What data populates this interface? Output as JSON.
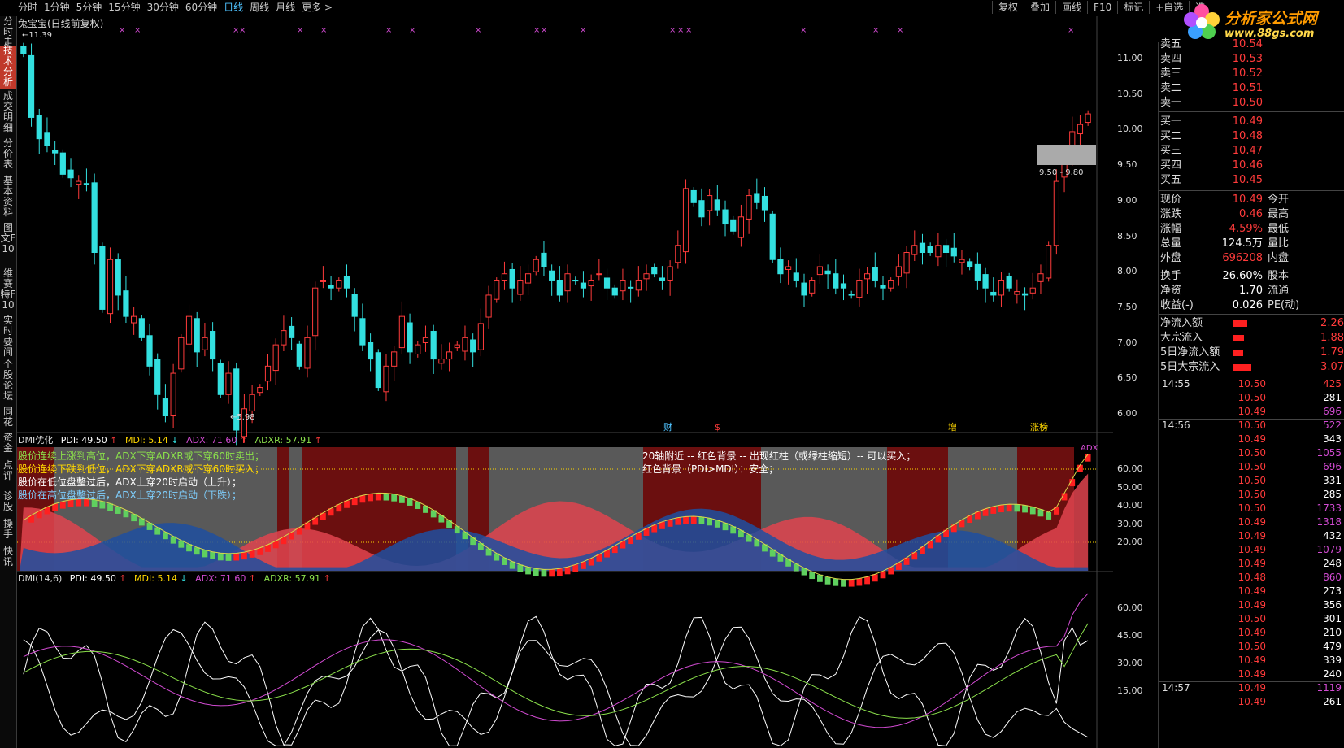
{
  "periods": [
    "分时",
    "1分钟",
    "5分钟",
    "15分钟",
    "30分钟",
    "60分钟",
    "日线",
    "周线",
    "月线",
    "更多 >"
  ],
  "active_period": "日线",
  "tools": [
    "复权",
    "叠加",
    "画线",
    "F10",
    "标记",
    "+自选",
    "选"
  ],
  "logo": {
    "line1": "分析家公式网",
    "line2": "www.88gs.com"
  },
  "left_tabs": [
    "分时走势",
    "技术分析",
    "成交明细",
    "分价表",
    "基本资料",
    "图文F10",
    "维赛特F10",
    "实时要闻",
    "个股论坛",
    "同花",
    "资金",
    "点评",
    "诊股",
    "操手",
    "快讯"
  ],
  "stock_title": "兔宝宝(日线前复权)",
  "candles_panel": {
    "high_label": "11.39",
    "low_label": "5.98",
    "range_label": "9.50 - 9.80",
    "y_ticks": [
      "11.00",
      "10.50",
      "10.00",
      "9.50",
      "9.00",
      "8.50",
      "8.00",
      "7.50",
      "7.00",
      "6.50",
      "6.00"
    ],
    "event_marks": [
      "财",
      "$",
      "增",
      "涨榜"
    ]
  },
  "dmi_opt": {
    "name": "DMI优化",
    "pdi": "PDI: 49.50",
    "mdi": "MDI: 5.14",
    "adx": "ADX: 71.60",
    "adxr": "ADXR: 57.91",
    "notes_left": [
      "股价连续上涨到高位，ADX下穿ADXR或下穿60时卖出；",
      "股价连续下跌到低位，ADX下穿ADXR或下穿60时买入；",
      "股价在低位盘整过后，ADX上穿20时启动（上升）；",
      "股价在高位盘整过后，ADX上穿20时启动（下跌）；"
    ],
    "notes_mid": [
      "20轴附近 -- 红色背景 -- 出现红柱（或绿柱缩短）-- 可以买入；",
      "红色背景（PDI>MDI）：安全；"
    ],
    "y_ticks": [
      "60.00",
      "50.00",
      "40.00",
      "30.00",
      "20.00"
    ],
    "tag": "ADX"
  },
  "dmi": {
    "name": "DMI(14,6)",
    "pdi": "PDI: 49.50",
    "mdi": "MDI: 5.14",
    "adx": "ADX: 71.60",
    "adxr": "ADXR: 57.91",
    "y_ticks": [
      "60.00",
      "45.00",
      "30.00",
      "15.00"
    ]
  },
  "quote": {
    "asks": [
      {
        "label": "卖五",
        "price": "10.54"
      },
      {
        "label": "卖四",
        "price": "10.53"
      },
      {
        "label": "卖三",
        "price": "10.52"
      },
      {
        "label": "卖二",
        "price": "10.51"
      },
      {
        "label": "卖一",
        "price": "10.50"
      }
    ],
    "bids": [
      {
        "label": "买一",
        "price": "10.49"
      },
      {
        "label": "买二",
        "price": "10.48"
      },
      {
        "label": "买三",
        "price": "10.47"
      },
      {
        "label": "买四",
        "price": "10.46"
      },
      {
        "label": "买五",
        "price": "10.45"
      }
    ],
    "stats": [
      {
        "l1": "现价",
        "v1": "10.49",
        "l2": "今开",
        "v2": ""
      },
      {
        "l1": "涨跌",
        "v1": "0.46",
        "l2": "最高",
        "v2": ""
      },
      {
        "l1": "涨幅",
        "v1": "4.59%",
        "l2": "最低",
        "v2": ""
      },
      {
        "l1": "总量",
        "v1": "124.5万",
        "l2": "量比",
        "v2": ""
      },
      {
        "l1": "外盘",
        "v1": "696208",
        "l2": "内盘",
        "v2": ""
      }
    ],
    "stats2": [
      {
        "l1": "换手",
        "v1": "26.60%",
        "l2": "股本",
        "v2": ""
      },
      {
        "l1": "净资",
        "v1": "1.70",
        "l2": "流通",
        "v2": ""
      },
      {
        "l1": "收益(-)",
        "v1": "0.026",
        "l2": "PE(动)",
        "v2": ""
      }
    ],
    "flows": [
      {
        "label": "净流入额",
        "value": "2.26",
        "bar": 0.75
      },
      {
        "label": "大宗流入",
        "value": "1.88",
        "bar": 0.6
      },
      {
        "label": "5日净流入额",
        "value": "1.79",
        "bar": 0.55
      },
      {
        "label": "5日大宗流入",
        "value": "3.07",
        "bar": 1.0
      }
    ],
    "ticks": [
      {
        "t": "14:55",
        "p": "10.50",
        "v": "425",
        "c": "#ff3b3b"
      },
      {
        "t": "",
        "p": "10.50",
        "v": "281",
        "c": "#ffffff"
      },
      {
        "t": "",
        "p": "10.49",
        "v": "696",
        "c": "#d24bd2"
      },
      {
        "t": "14:56",
        "p": "10.50",
        "v": "522",
        "c": "#d24bd2"
      },
      {
        "t": "",
        "p": "10.49",
        "v": "343",
        "c": "#ffffff"
      },
      {
        "t": "",
        "p": "10.50",
        "v": "1055",
        "c": "#d24bd2"
      },
      {
        "t": "",
        "p": "10.50",
        "v": "696",
        "c": "#d24bd2"
      },
      {
        "t": "",
        "p": "10.50",
        "v": "331",
        "c": "#ffffff"
      },
      {
        "t": "",
        "p": "10.50",
        "v": "285",
        "c": "#ffffff"
      },
      {
        "t": "",
        "p": "10.50",
        "v": "1733",
        "c": "#d24bd2"
      },
      {
        "t": "",
        "p": "10.49",
        "v": "1318",
        "c": "#d24bd2"
      },
      {
        "t": "",
        "p": "10.49",
        "v": "432",
        "c": "#ffffff"
      },
      {
        "t": "",
        "p": "10.49",
        "v": "1079",
        "c": "#d24bd2"
      },
      {
        "t": "",
        "p": "10.49",
        "v": "248",
        "c": "#ffffff"
      },
      {
        "t": "",
        "p": "10.48",
        "v": "860",
        "c": "#d24bd2"
      },
      {
        "t": "",
        "p": "10.49",
        "v": "273",
        "c": "#ffffff"
      },
      {
        "t": "",
        "p": "10.49",
        "v": "356",
        "c": "#ffffff"
      },
      {
        "t": "",
        "p": "10.50",
        "v": "301",
        "c": "#ffffff"
      },
      {
        "t": "",
        "p": "10.49",
        "v": "210",
        "c": "#ffffff"
      },
      {
        "t": "",
        "p": "10.50",
        "v": "479",
        "c": "#ffffff"
      },
      {
        "t": "",
        "p": "10.49",
        "v": "339",
        "c": "#ffffff"
      },
      {
        "t": "",
        "p": "10.49",
        "v": "240",
        "c": "#ffffff"
      },
      {
        "t": "14:57",
        "p": "10.49",
        "v": "1119",
        "c": "#d24bd2"
      },
      {
        "t": "",
        "p": "10.49",
        "v": "261",
        "c": "#ffffff"
      }
    ]
  },
  "colors": {
    "up": "#ff3b3b",
    "down": "#33e0e0",
    "accent": "#4fc3ff",
    "pdi": "#ffffff",
    "mdi": "#ffd700",
    "adx": "#d24bd2",
    "adxr": "#8be04b"
  }
}
